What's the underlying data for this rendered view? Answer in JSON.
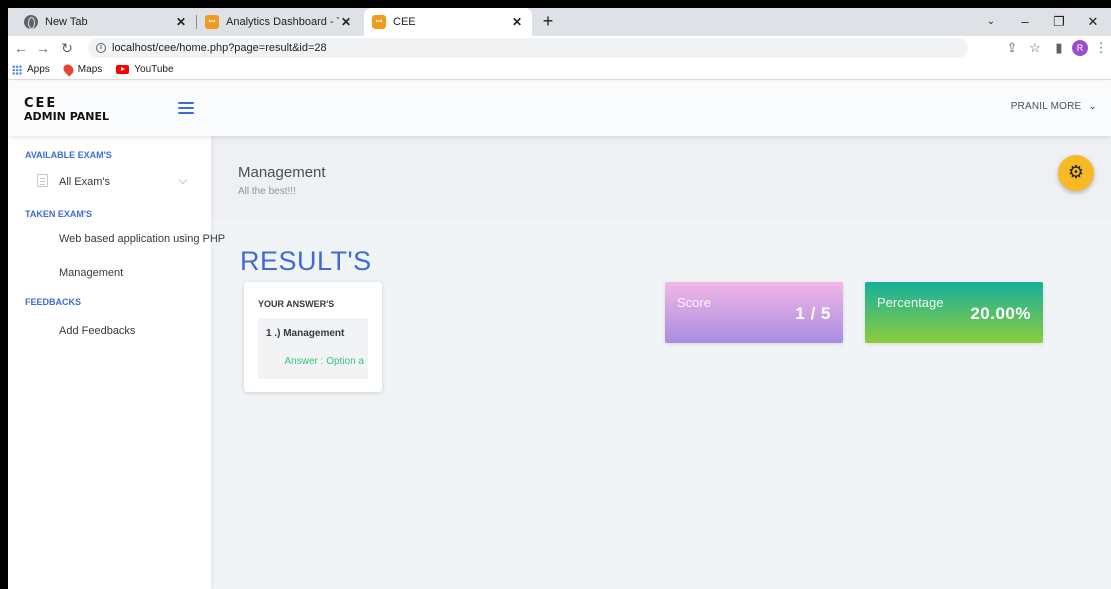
{
  "browser": {
    "tabs": [
      {
        "title": "New Tab",
        "icon": "chrome-globe-icon"
      },
      {
        "title": "Analytics Dashboard - This is an example dashboard",
        "icon": "xampp-icon"
      },
      {
        "title": "CEE",
        "icon": "xampp-icon"
      }
    ],
    "url": "localhost/cee/home.php?page=result&id=28",
    "profile_initial": "R",
    "bookmarks": [
      {
        "label": "Apps",
        "icon": "apps-grid-icon"
      },
      {
        "label": "Maps",
        "icon": "maps-pin-icon"
      },
      {
        "label": "YouTube",
        "icon": "youtube-icon"
      }
    ]
  },
  "header": {
    "logo_line1": "CEE",
    "logo_line2": "ADMIN PANEL",
    "user_name": "PRANIL MORE",
    "user_chevron": "⌄"
  },
  "sidebar": {
    "sections": [
      {
        "heading": "AVAILABLE EXAM'S",
        "items": [
          {
            "label": "All Exam's"
          }
        ]
      },
      {
        "heading": "TAKEN EXAM'S",
        "items": [
          {
            "label": "Web based application using PHP"
          },
          {
            "label": "Management"
          }
        ]
      },
      {
        "heading": "FEEDBACKS",
        "items": [
          {
            "label": "Add Feedbacks"
          }
        ]
      }
    ]
  },
  "page": {
    "title": "Management",
    "subtitle": "All the best!!!",
    "results_heading": "RESULT'S"
  },
  "answers": {
    "title": "YOUR ANSWER'S",
    "question": "1 .) Management",
    "answer": "Answer : Option a"
  },
  "stats": {
    "score_label": "Score",
    "score_value": "1 / 5",
    "percentage_label": "Percentage",
    "percentage_value": "20.00%"
  },
  "colors": {
    "accent": "#3f6ad8",
    "fab": "#f7b924",
    "answer_text": "#3ac47d"
  }
}
